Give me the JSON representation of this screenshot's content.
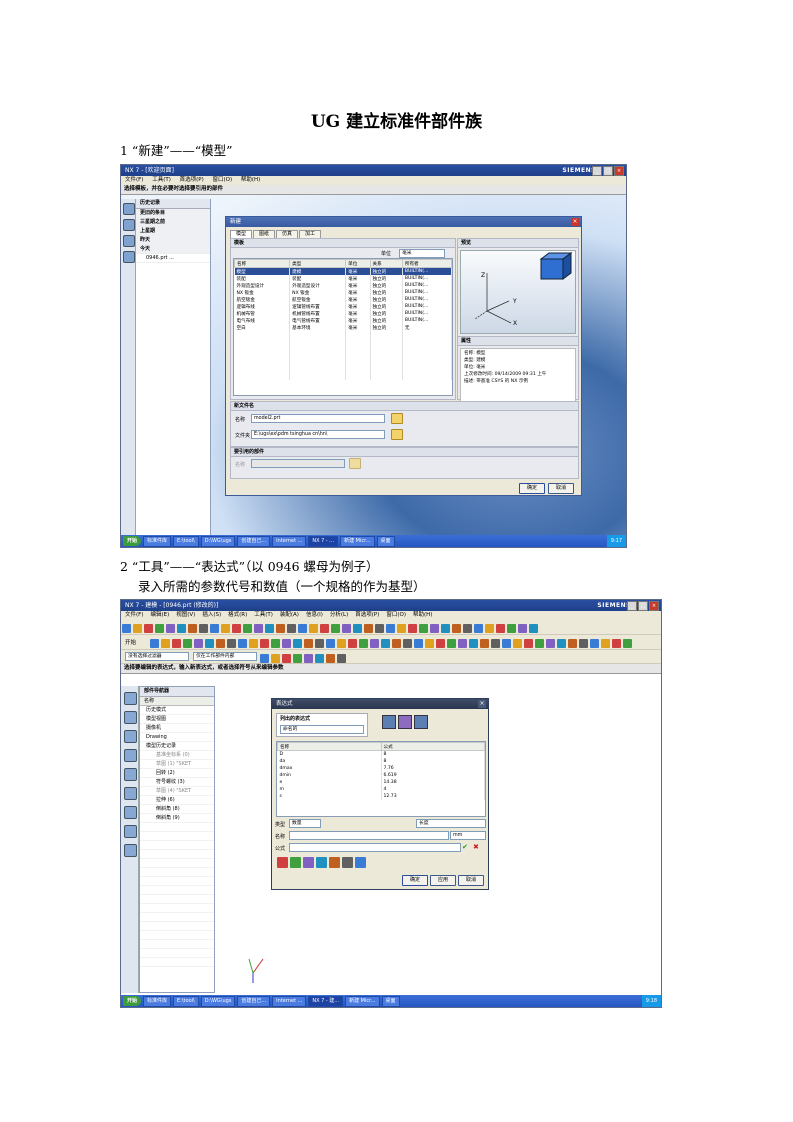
{
  "title": "UG 建立标准件部件族",
  "step1": {
    "text": "1 “新建”——“模型”"
  },
  "step2": {
    "line1": "2 “工具”——“表达式”（以 0946 螺母为例子）",
    "line2": "录入所需的参数代号和数值（一个规格的作为基型）"
  },
  "shot1": {
    "window_title": "NX 7 - [欢迎页面]",
    "brand": "SIEMENS",
    "menu": [
      "文件(F)",
      "工具(T)",
      "首选项(P)",
      "窗口(O)",
      "帮助(H)"
    ],
    "cue": "选择模板，并在必要时选择要引用的部件",
    "history": {
      "header": "历史记录",
      "groups": [
        "更旧的条目",
        "三星期之前",
        "上星期",
        "昨天",
        "今天"
      ],
      "file": "0946.prt ..."
    },
    "dialog": {
      "title": "新建",
      "tabs": [
        "模型",
        "图纸",
        "仿真",
        "加工"
      ],
      "template_section": "模板",
      "units_label": "单位",
      "units_value": "毫米",
      "columns": [
        "名称",
        "类型",
        "单位",
        "关系",
        "所有者"
      ],
      "rows": [
        [
          "模型",
          "建模",
          "毫米",
          "独立的",
          "BUILTIN(..."
        ],
        [
          "装配",
          "装配",
          "毫米",
          "独立的",
          "BUILTIN(..."
        ],
        [
          "外观造型设计",
          "外观造型设计",
          "毫米",
          "独立的",
          "BUILTIN(..."
        ],
        [
          "NX 钣金",
          "NX 钣金",
          "毫米",
          "独立的",
          "BUILTIN(..."
        ],
        [
          "航空钣金",
          "航空钣金",
          "毫米",
          "独立的",
          "BUILTIN(..."
        ],
        [
          "逻辑布线",
          "逻辑管线布置",
          "毫米",
          "独立的",
          "BUILTIN(..."
        ],
        [
          "机械布管",
          "机械管线布置",
          "毫米",
          "独立的",
          "BUILTIN(..."
        ],
        [
          "电气布线",
          "电气管线布置",
          "毫米",
          "独立的",
          "BUILTIN(..."
        ],
        [
          "空白",
          "基本环境",
          "毫米",
          "独立的",
          "无"
        ]
      ],
      "preview_section": "预览",
      "props_section": "属性",
      "props": [
        "名称: 模型",
        "类型: 建模",
        "单位: 毫米",
        "上次修改时间: 09/14/2009 09:31 上午",
        "描述: 带基准 CSYS 的 NX 示例"
      ],
      "newfile_section": "新文件名",
      "name_label": "名称",
      "name_value": "model2.prt",
      "folder_label": "文件夹",
      "folder_value": "E:\\ugs\\ex\\pdm tsinghua cn\\hn\\",
      "ref_section": "要引用的部件",
      "ref_name_label": "名称",
      "ok": "确定",
      "cancel": "取消"
    },
    "taskbar": [
      "开始",
      "标准件库",
      "E:\\tool\\",
      "D:\\WG\\ugs",
      "创建自己...",
      "Internet ...",
      "NX 7 - ...",
      "新建 Micr...",
      "桌面"
    ],
    "clock": "9:17"
  },
  "shot2": {
    "window_title": "NX 7 - 建模 - [0946.prt (修改的)]",
    "brand": "SIEMENS",
    "menu": [
      "文件(F)",
      "编辑(E)",
      "视图(V)",
      "插入(S)",
      "格式(R)",
      "工具(T)",
      "装配(A)",
      "信息(I)",
      "分析(L)",
      "首选项(P)",
      "窗口(O)",
      "帮助(H)"
    ],
    "start_label": "开始",
    "filter_value": "没有选择过滤器",
    "scope_value": "仅在工作部件内部",
    "cue": "选择要编辑的表达式，输入新表达式，或者选择符号从来编辑参数",
    "navigator": {
      "header": "部件导航器",
      "col": "名称",
      "items": [
        "历史模式",
        "模型视图",
        "摄像机",
        "Drawing",
        "模型历史记录",
        "基准坐标系 (0)",
        "草图 (1) \"SKET",
        "回转 (2)",
        "符号螺纹 (3)",
        "草图 (4) \"SKET",
        "拉伸 (6)",
        "倒斜角 (8)",
        "倒斜角 (9)"
      ]
    },
    "dialog": {
      "title": "表达式",
      "list_label": "列出的表达式",
      "list_value": "命名的",
      "col_name": "名称",
      "col_formula": "公式",
      "rows": [
        [
          "D",
          "8"
        ],
        [
          "da",
          "8"
        ],
        [
          "dmax",
          "7.76"
        ],
        [
          "dmin",
          "6.619"
        ],
        [
          "e",
          "14.38"
        ],
        [
          "m",
          "4"
        ],
        [
          "s",
          "12.73"
        ]
      ],
      "type_label": "类型",
      "type_value": "数量",
      "unit_value": "长度",
      "name_label": "名称",
      "unit_small": "mm",
      "formula_label": "公式",
      "ok": "确定",
      "apply": "应用",
      "cancel": "取消"
    },
    "taskbar": [
      "开始",
      "标准件库",
      "E:\\tool\\",
      "D:\\WG\\ugs",
      "创建自己...",
      "Internet ...",
      "NX 7 - 建...",
      "新建 Micr...",
      "桌面"
    ],
    "clock": "9:18"
  }
}
